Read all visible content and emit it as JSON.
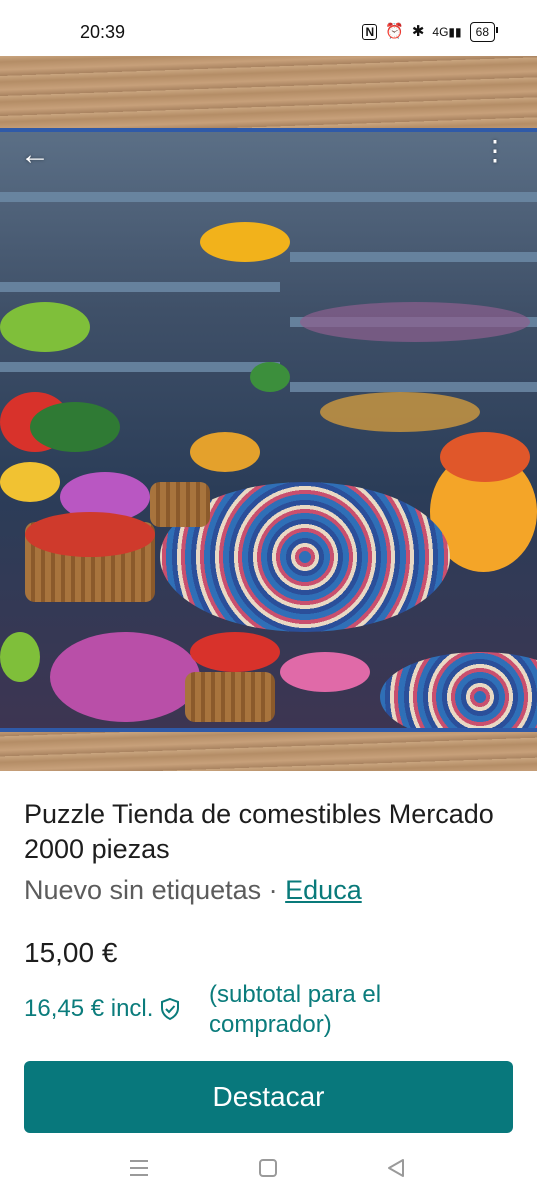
{
  "status_bar": {
    "time": "20:39",
    "icons": [
      "nfc-icon",
      "alarm-icon",
      "bluetooth-icon",
      "signal-4g-icon"
    ],
    "nfc_label": "N",
    "network_label": "4G",
    "battery": "68"
  },
  "gallery": {
    "image_count": 2,
    "active_index": 0
  },
  "product": {
    "title": "Puzzle Tienda de comestibles Mercado 2000 piezas",
    "condition": "Nuevo sin etiquetas",
    "separator": " · ",
    "brand": "Educa",
    "price": "15,00 €",
    "buyer_price": "16,45 € incl.",
    "buyer_note": "(subtotal para el comprador)"
  },
  "actions": {
    "highlight_button": "Destacar"
  },
  "colors": {
    "accent": "#08787C",
    "text": "#1D1D1D",
    "muted": "#5C5C5C"
  }
}
